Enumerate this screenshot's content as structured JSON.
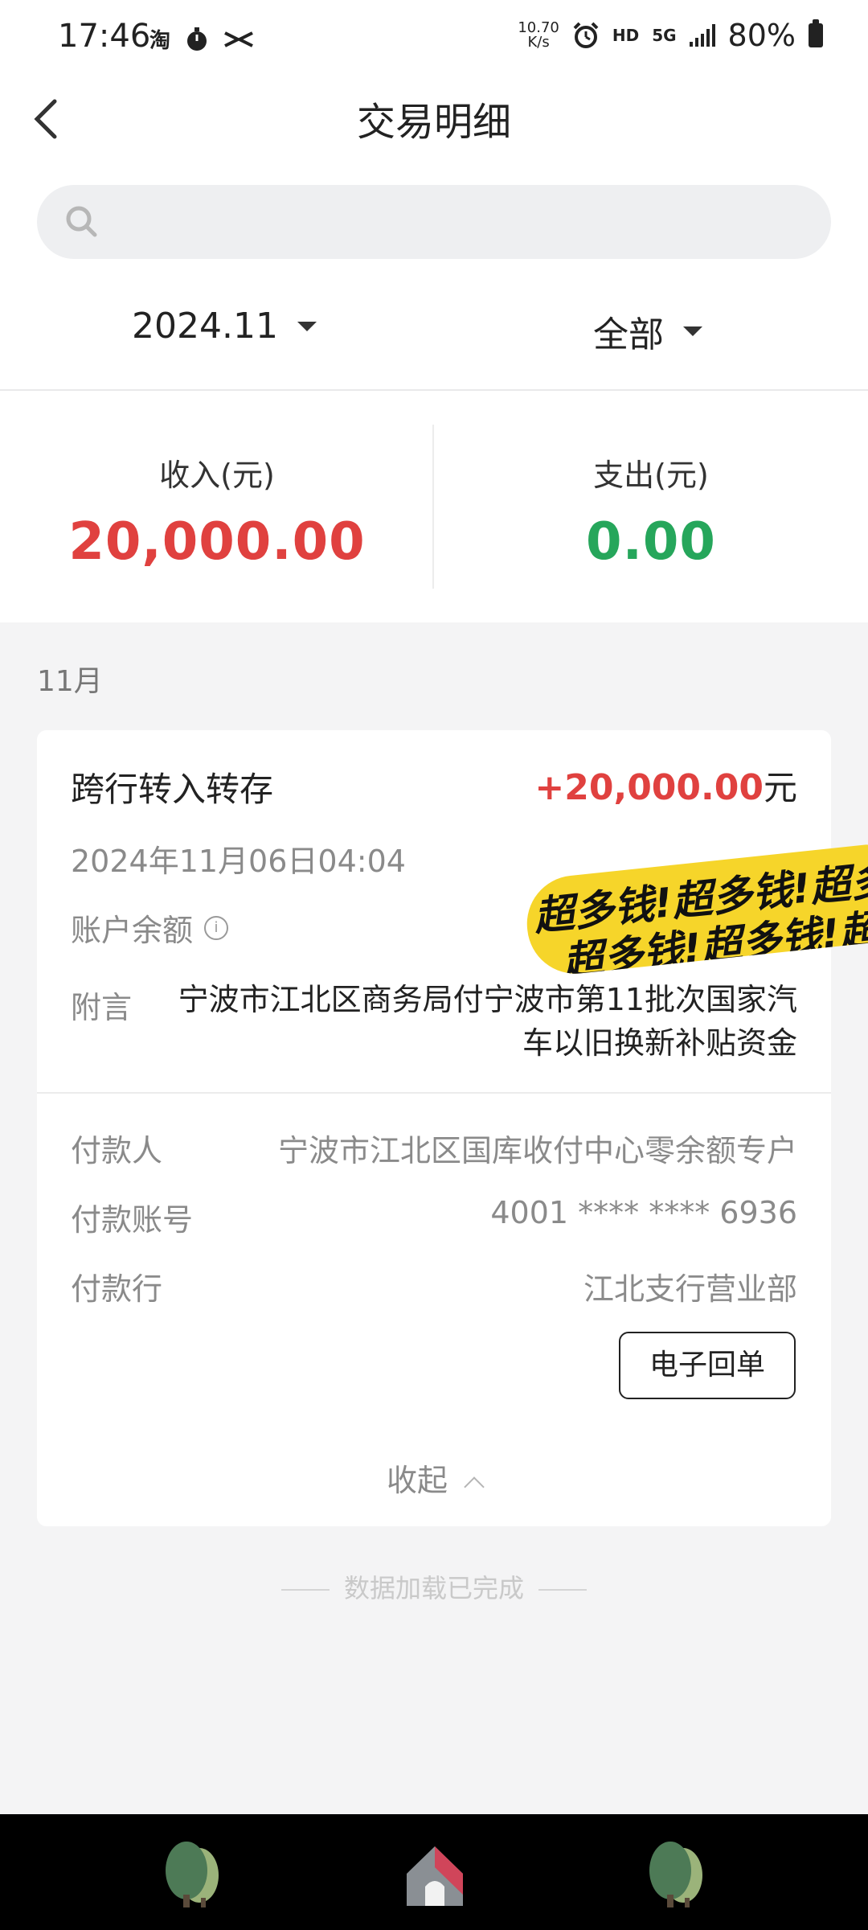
{
  "status_bar": {
    "time": "17:46",
    "net_speed_value": "10.70",
    "net_speed_unit": "K/s",
    "hd": "HD",
    "network": "5G",
    "battery": "80%"
  },
  "header": {
    "title": "交易明细",
    "search_placeholder": ""
  },
  "filters": {
    "month": "2024.11",
    "type": "全部"
  },
  "summary": {
    "income_label": "收入(元)",
    "income_value": "20,000.00",
    "expense_label": "支出(元)",
    "expense_value": "0.00"
  },
  "month_header": "11月",
  "transaction": {
    "title": "跨行转入转存",
    "amount": "+20,000.00",
    "unit": "元",
    "datetime": "2024年11月06日04:04",
    "balance_label": "账户余额",
    "memo_label": "附言",
    "memo": "宁波市江北区商务局付宁波市第11批次国家汽车以旧换新补贴资金",
    "payer_label": "付款人",
    "payer": "宁波市江北区国库收付中心零余额专户",
    "account_label": "付款账号",
    "account": "4001 **** **** 6936",
    "bank_label": "付款行",
    "bank": "江北支行营业部",
    "receipt_button": "电子回单",
    "collapse": "收起"
  },
  "sticker": {
    "line1": "超多钱!超多钱!超多",
    "line2": "超多钱!超多钱!超"
  },
  "footer_status": "数据加载已完成",
  "colors": {
    "income": "#e0413f",
    "expense": "#26a65b",
    "sticker": "#f6d52a"
  }
}
